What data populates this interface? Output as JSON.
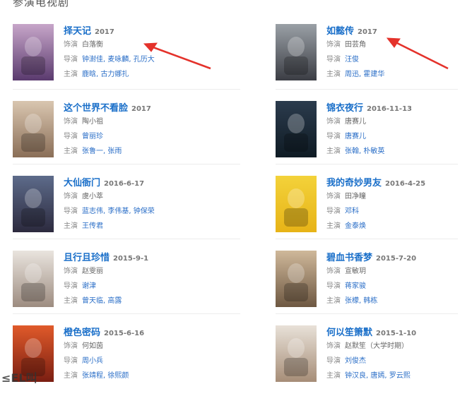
{
  "section_title": "参演电视剧",
  "labels": {
    "role": "饰演",
    "director": "导演",
    "cast": "主演"
  },
  "items": [
    {
      "title": "择天记",
      "date": "2017",
      "role": "白落衡",
      "director": "钟澍佳, 麦咏麟, 孔历大",
      "cast": "鹿晗, 古力娜扎",
      "colors": [
        "#c7a6c9",
        "#5a3a6e"
      ]
    },
    {
      "title": "如懿传",
      "date": "2017",
      "role": "田芸角",
      "director": "汪俊",
      "cast": "周迅, 霍建华",
      "colors": [
        "#9aa0a6",
        "#3b3d44"
      ]
    },
    {
      "title": "这个世界不看脸",
      "date": "2017",
      "role": "陶小祖",
      "director": "曾丽珍",
      "cast": "张鲁一, 张雨",
      "colors": [
        "#d9c6b0",
        "#8a6e57"
      ]
    },
    {
      "title": "锦衣夜行",
      "date": "2016-11-13",
      "role": "唐赛儿",
      "director": "唐赛儿",
      "cast": "张翰, 朴敏英",
      "colors": [
        "#2b3b4d",
        "#0f1b24"
      ]
    },
    {
      "title": "大仙衙门",
      "date": "2016-6-17",
      "role": "虞小萃",
      "director": "蓝志伟, 李伟基, 钟保荣",
      "cast": "王传君",
      "colors": [
        "#5d6b8a",
        "#2c2a3e"
      ]
    },
    {
      "title": "我的奇妙男友",
      "date": "2016-4-25",
      "role": "田净瞳",
      "director": "邓科",
      "cast": "金泰焕",
      "colors": [
        "#f3d23a",
        "#e7b317"
      ]
    },
    {
      "title": "且行且珍惜",
      "date": "2015-9-1",
      "role": "赵雯丽",
      "director": "谢津",
      "cast": "曾天临, 高露",
      "colors": [
        "#e9e4de",
        "#9d8c80"
      ]
    },
    {
      "title": "碧血书香梦",
      "date": "2015-7-20",
      "role": "宣敏玥",
      "director": "蒋家骏",
      "cast": "张檬, 韩栋",
      "colors": [
        "#cfb89a",
        "#6e5842"
      ]
    },
    {
      "title": "橙色密码",
      "date": "2015-6-16",
      "role": "何如茵",
      "director": "周小兵",
      "cast": "张靖程, 徐熙颜",
      "colors": [
        "#e05a2a",
        "#7a1e12"
      ]
    },
    {
      "title": "何以笙箫默",
      "date": "2015-1-10",
      "role": "赵默笙（大学时期）",
      "director": "刘俊杰",
      "cast": "钟汉良, 唐嫣, 罗云熙",
      "colors": [
        "#e8e1d8",
        "#a68d77"
      ]
    }
  ],
  "overlay_text": "≤EL叫"
}
